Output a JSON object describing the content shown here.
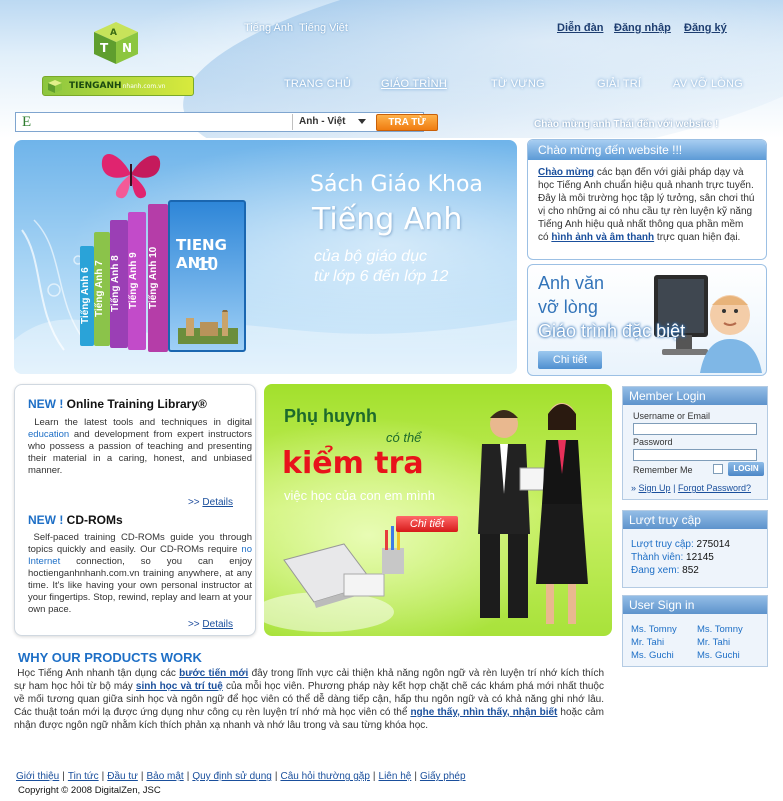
{
  "header": {
    "logo_text": "TIENGANH",
    "logo_sub": "nhanh.com.vn",
    "languages": [
      "Tiếng Anh",
      "Tiếng Việt"
    ],
    "top_links": [
      "Diễn đàn",
      "Đăng nhập",
      "Đăng ký"
    ],
    "nav": [
      "TRANG CHỦ",
      "GIÁO TRÌNH",
      "TỪ VỰNG",
      "GIẢI TRÍ",
      "AV VỠ LÒNG"
    ],
    "nav_active": "GIÁO TRÌNH"
  },
  "search": {
    "prefix_icon": "E",
    "query": "",
    "placeholder": "",
    "dictionary": "Anh - Việt",
    "button": "TRA TỪ"
  },
  "welcome_line": "Chào mừng anh Thái đến với website !",
  "hero": {
    "title1": "Sách Giáo Khoa",
    "title2": "Tiếng Anh",
    "sub1": "của bộ giáo dục",
    "sub2": "từ lớp 6 đến lớp 12",
    "book_title": "TIENG ANH",
    "book_number": "10",
    "spines": [
      "Tiếng Anh 6",
      "Tiếng Anh 7",
      "Tiếng Anh 8",
      "Tiếng Anh 9",
      "Tiếng Anh 10"
    ]
  },
  "welcome_panel": {
    "title": "Chào mừng đến website !!!",
    "link1": "Chào mừng",
    "text1": " các bạn đến với giải pháp dạy và học Tiếng Anh chuẩn hiệu quả nhanh trực tuyến. Đây là môi trường học tập lý tưởng, sân chơi thú vị cho những ai có nhu cầu tự rèn luyện kỹ năng Tiếng Anh hiệu quả nhất thông qua phần mềm có ",
    "link2": "hình ảnh và âm thanh",
    "text2": " trực quan hiện đại."
  },
  "kid_panel": {
    "line1": "Anh văn",
    "line2": "vỡ lòng",
    "line3": "Giáo trình đặc biệt",
    "button": "Chi tiết"
  },
  "library": {
    "new_label": "NEW !",
    "title1": "Online Training Library®",
    "body1_a": "Learn the latest tools and techniques in digital ",
    "body1_link": "education",
    "body1_b": " and development from expert instructors who possess a passion of teaching and presenting their material in a caring, honest, and unbiased manner.",
    "details": "Details",
    "details_prefix": ">>",
    "title2": "CD-ROMs",
    "body2_a": "Self-paced training CD-ROMs guide you through topics quickly and easily. Our CD-ROMs require ",
    "body2_link": "no Internet",
    "body2_b": " connection, so you can enjoy hoctienganhnhanh.com.vn training anywhere, at any time. It's like having your own personal instructor at your fingertips. Stop, rewind, replay and learn at your own pace."
  },
  "parent_banner": {
    "line1": "Phụ huynh",
    "line2": "có thể",
    "line3": "kiểm tra",
    "line4": "việc học của con em mình",
    "button": "Chi tiết"
  },
  "login": {
    "title": "Member Login",
    "username_label": "Username or Email",
    "password_label": "Password",
    "remember_label": "Remember Me",
    "button": "LOGIN",
    "signup": "Sign Up",
    "forgot": "Forgot Password?"
  },
  "visits": {
    "title": "Lượt truy cập",
    "rows": [
      {
        "label": "Lượt truy cập:",
        "value": "275014"
      },
      {
        "label": "Thành viên:",
        "value": "12145"
      },
      {
        "label": "Đang xem:",
        "value": "852"
      }
    ]
  },
  "users": {
    "title": "User Sign in",
    "left": [
      "Ms. Tomny",
      "Mr. Tahi",
      "Ms. Guchi"
    ],
    "right": [
      "Ms. Tomny",
      "Mr. Tahi",
      "Ms. Guchi"
    ]
  },
  "why": {
    "title": "WHY OUR PRODUCTS WORK",
    "t1": "Học Tiếng Anh nhanh tận dụng các ",
    "l1": "bước tiến mới",
    "t2": " đây trong lĩnh vực cải thiện khả năng ngôn ngữ và rèn luyện trí nhớ kích thích sự ham học hỏi từ bộ máy ",
    "l2": "sinh học và trí tuệ",
    "t3": " của mỗi học viên. Phương pháp này kết hợp chặt chẽ các khám phá mới nhất thuộc về mối tương quan giữa sinh học và ngôn ngữ để học viên có thể dễ dàng tiếp cận, hấp thu ngôn ngữ và có khả năng ghi nhớ lâu. Các thuật toán mới lạ được ứng dụng như công cụ rèn luyện trí nhớ mà học viên có thể ",
    "l3": "nghe thấy, nhìn thấy, nhận biết",
    "t4": " hoặc cảm nhận được ngôn ngữ nhằm kích thích phản xạ nhanh và nhớ lâu trong và sau từng khóa học."
  },
  "footer": {
    "links": [
      "Giới thiệu",
      "Tin tức",
      "Đầu tư",
      "Bảo mật",
      "Quy định sử dụng",
      "Câu hỏi thường gặp",
      "Liên hệ",
      "Giấy phép"
    ],
    "copyright": "Copyright © 2008 DigitalZen, JSC"
  },
  "colors": {
    "brand_blue": "#1e6fc6",
    "header_blue": "#5c9ad6",
    "banner_green": "#a2e02c",
    "accent_red": "#e8131b",
    "button_orange": "#f07c10"
  }
}
